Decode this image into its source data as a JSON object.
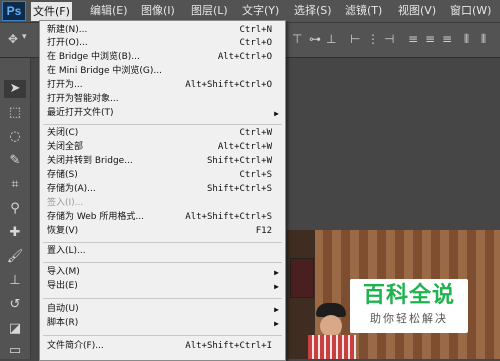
{
  "app": {
    "logo": "Ps"
  },
  "menubar": {
    "items": [
      {
        "label": "文件(F)"
      },
      {
        "label": "编辑(E)"
      },
      {
        "label": "图像(I)"
      },
      {
        "label": "图层(L)"
      },
      {
        "label": "文字(Y)"
      },
      {
        "label": "选择(S)"
      },
      {
        "label": "滤镜(T)"
      },
      {
        "label": "视图(V)"
      },
      {
        "label": "窗口(W)"
      }
    ],
    "active_index": 0
  },
  "file_menu": {
    "items": [
      {
        "label": "新建(N)...",
        "shortcut": "Ctrl+N"
      },
      {
        "label": "打开(O)...",
        "shortcut": "Ctrl+O"
      },
      {
        "label": "在 Bridge 中浏览(B)...",
        "shortcut": "Alt+Ctrl+O"
      },
      {
        "label": "在 Mini Bridge 中浏览(G)...",
        "shortcut": ""
      },
      {
        "label": "打开为...",
        "shortcut": "Alt+Shift+Ctrl+O"
      },
      {
        "label": "打开为智能对象...",
        "shortcut": ""
      },
      {
        "label": "最近打开文件(T)",
        "shortcut": "",
        "submenu": true
      },
      {
        "label": "关闭(C)",
        "shortcut": "Ctrl+W"
      },
      {
        "label": "关闭全部",
        "shortcut": "Alt+Ctrl+W"
      },
      {
        "label": "关闭并转到 Bridge...",
        "shortcut": "Shift+Ctrl+W"
      },
      {
        "label": "存储(S)",
        "shortcut": "Ctrl+S"
      },
      {
        "label": "存储为(A)...",
        "shortcut": "Shift+Ctrl+S"
      },
      {
        "label": "签入(I)...",
        "shortcut": "",
        "disabled": true
      },
      {
        "label": "存储为 Web 所用格式...",
        "shortcut": "Alt+Shift+Ctrl+S"
      },
      {
        "label": "恢复(V)",
        "shortcut": "F12"
      },
      {
        "label": "置入(L)...",
        "shortcut": ""
      },
      {
        "label": "导入(M)",
        "shortcut": "",
        "submenu": true
      },
      {
        "label": "导出(E)",
        "shortcut": "",
        "submenu": true
      },
      {
        "label": "自动(U)",
        "shortcut": "",
        "submenu": true
      },
      {
        "label": "脚本(R)",
        "shortcut": "",
        "submenu": true
      },
      {
        "label": "文件简介(F)...",
        "shortcut": "Alt+Shift+Ctrl+I"
      }
    ]
  },
  "watermark": {
    "title": "百科全说",
    "subtitle": "助你轻松解决"
  },
  "colors": {
    "menubar_bg": "#535353",
    "menu_bg": "#f0f0f0",
    "ps_blue": "#5fb1ff",
    "watermark_green": "#1eb34e"
  }
}
